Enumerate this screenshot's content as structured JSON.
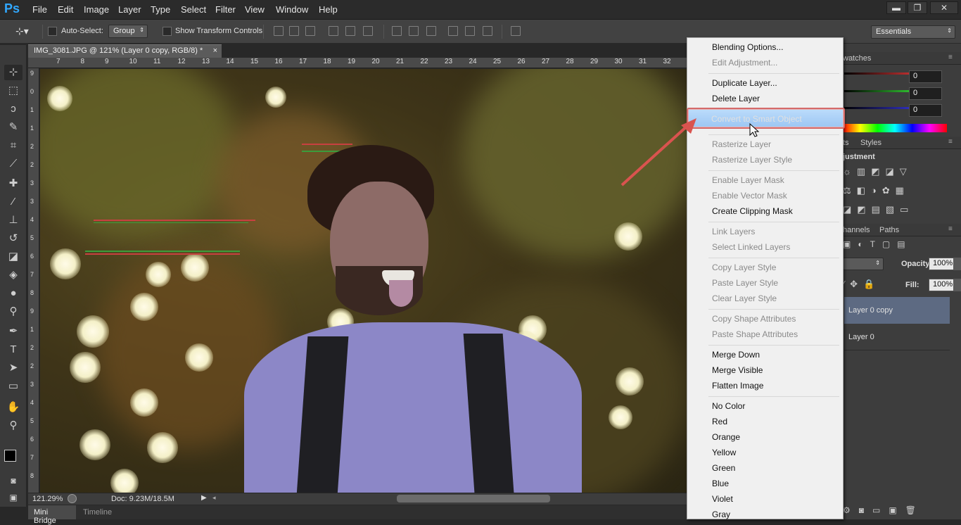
{
  "app": {
    "logo": "Ps"
  },
  "menu": [
    "File",
    "Edit",
    "Image",
    "Layer",
    "Type",
    "Select",
    "Filter",
    "View",
    "Window",
    "Help"
  ],
  "window_controls": {
    "minimize": "▬",
    "restore": "❐",
    "close": "✕"
  },
  "options": {
    "auto_select_label": "Auto-Select:",
    "auto_select_value": "Group",
    "transform_label": "Show Transform Controls",
    "workspace": "Essentials"
  },
  "document": {
    "tab_title": "IMG_3081.JPG @ 121% (Layer 0 copy, RGB/8) *",
    "tab_close": "×",
    "ruler_h": [
      "7",
      "8",
      "9",
      "10",
      "11",
      "12",
      "13",
      "14",
      "15",
      "16",
      "17",
      "18",
      "19",
      "20",
      "21",
      "22",
      "23",
      "24",
      "25",
      "26",
      "27",
      "28",
      "29",
      "30",
      "31",
      "32"
    ],
    "ruler_v": [
      "9",
      "0",
      "1",
      "1",
      "2",
      "2",
      "3",
      "3",
      "4",
      "5",
      "6",
      "7",
      "8",
      "9",
      "1",
      "2",
      "2",
      "3",
      "4",
      "5",
      "6",
      "7",
      "8"
    ]
  },
  "status": {
    "zoom": "121.29%",
    "doc": "Doc: 9.23M/18.5M"
  },
  "bottom_tabs": [
    "Mini Bridge",
    "Timeline"
  ],
  "panels": {
    "swatches_tab": "watches",
    "color_values": [
      "0",
      "0",
      "0"
    ],
    "adjust_tabs": [
      "ts",
      "Styles"
    ],
    "adjust_title": "justment",
    "layers_tabs": [
      "hannels",
      "Paths"
    ],
    "opacity_label": "Opacity:",
    "opacity_value": "100%",
    "fill_label": "Fill:",
    "fill_value": "100%",
    "layers": [
      "Layer 0 copy",
      "Layer 0"
    ]
  },
  "context_menu": {
    "items": [
      {
        "label": "Blending Options...",
        "disabled": false
      },
      {
        "label": "Edit Adjustment...",
        "disabled": true
      },
      {
        "label": "Duplicate Layer...",
        "disabled": false
      },
      {
        "label": "Delete Layer",
        "disabled": false
      },
      {
        "label": "Convert to Smart Object",
        "disabled": false,
        "highlighted": true
      },
      {
        "label": "Rasterize Layer",
        "disabled": true
      },
      {
        "label": "Rasterize Layer Style",
        "disabled": true
      },
      {
        "label": "Enable Layer Mask",
        "disabled": true
      },
      {
        "label": "Enable Vector Mask",
        "disabled": true
      },
      {
        "label": "Create Clipping Mask",
        "disabled": false
      },
      {
        "label": "Link Layers",
        "disabled": true
      },
      {
        "label": "Select Linked Layers",
        "disabled": true
      },
      {
        "label": "Copy Layer Style",
        "disabled": true
      },
      {
        "label": "Paste Layer Style",
        "disabled": true
      },
      {
        "label": "Clear Layer Style",
        "disabled": true
      },
      {
        "label": "Copy Shape Attributes",
        "disabled": true
      },
      {
        "label": "Paste Shape Attributes",
        "disabled": true
      },
      {
        "label": "Merge Down",
        "disabled": false
      },
      {
        "label": "Merge Visible",
        "disabled": false
      },
      {
        "label": "Flatten Image",
        "disabled": false
      },
      {
        "label": "No Color",
        "disabled": false
      },
      {
        "label": "Red",
        "disabled": false
      },
      {
        "label": "Orange",
        "disabled": false
      },
      {
        "label": "Yellow",
        "disabled": false
      },
      {
        "label": "Green",
        "disabled": false
      },
      {
        "label": "Blue",
        "disabled": false
      },
      {
        "label": "Violet",
        "disabled": false
      },
      {
        "label": "Gray",
        "disabled": false
      }
    ]
  },
  "colors": {
    "accent": "#31a8ff",
    "highlight": "#a9d0f5",
    "annotation": "#d9534f"
  }
}
